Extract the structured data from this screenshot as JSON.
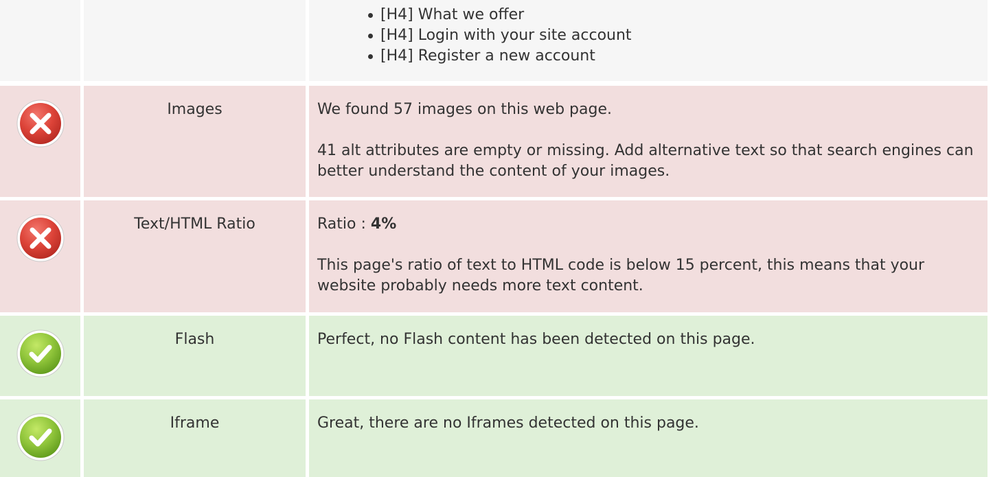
{
  "headings": {
    "items": [
      "[H4] What we offer",
      "[H4] Login with your site account",
      "[H4] Register a new account"
    ]
  },
  "rows": [
    {
      "status": "error",
      "icon": "error-x-icon",
      "name": "Images",
      "line1": "We found 57 images on this web page.",
      "line2": "41 alt attributes are empty or missing. Add alternative text so that search engines can better understand the content of your images."
    },
    {
      "status": "error",
      "icon": "error-x-icon",
      "name": "Text/HTML Ratio",
      "ratio_label": "Ratio : ",
      "ratio_value": "4%",
      "line2": "This page's ratio of text to HTML code is below 15 percent, this means that your website probably needs more text content."
    },
    {
      "status": "ok",
      "icon": "check-icon",
      "name": "Flash",
      "line1": "Perfect, no Flash content has been detected on this page."
    },
    {
      "status": "ok",
      "icon": "check-icon",
      "name": "Iframe",
      "line1": "Great, there are no Iframes detected on this page."
    }
  ],
  "colors": {
    "error_background": "#f2dede",
    "ok_background": "#dff0d8",
    "neutral_background": "#f6f6f6",
    "error_icon": "#d9453d",
    "ok_icon": "#8cc63f"
  }
}
